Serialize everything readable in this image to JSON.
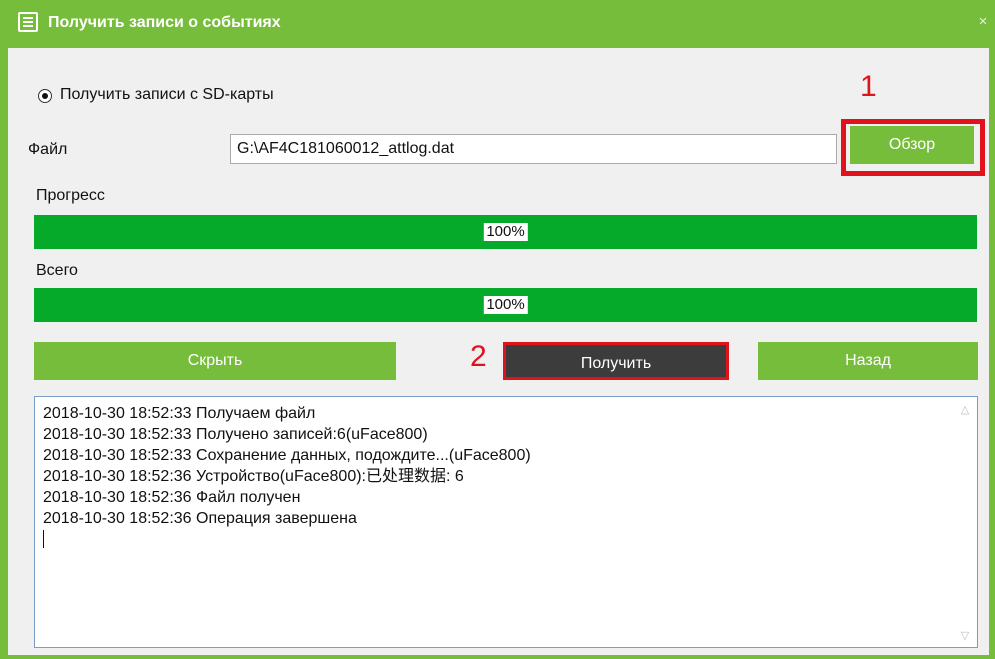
{
  "window": {
    "title": "Получить записи о событиях",
    "close_symbol": "×",
    "title_icon": "list-document-icon"
  },
  "source": {
    "radio_label": "Получить записи с SD-карты",
    "selected": true
  },
  "file": {
    "label": "Файл",
    "value": "G:\\AF4C181060012_attlog.dat",
    "browse_label": "Обзор"
  },
  "progress": {
    "label": "Прогресс",
    "value_text": "100%",
    "value": 100
  },
  "total": {
    "label": "Всего",
    "value_text": "100%",
    "value": 100
  },
  "buttons": {
    "hide_label": "Скрыть",
    "get_label": "Получить",
    "back_label": "Назад"
  },
  "annotations": {
    "marker_1": "1",
    "marker_2": "2",
    "color": "#e0121b"
  },
  "log": {
    "lines": [
      "2018-10-30 18:52:33 Получаем файл",
      "2018-10-30 18:52:33 Получено записей:6(uFace800)",
      "2018-10-30 18:52:33 Сохранение данных, подождите...(uFace800)",
      "2018-10-30 18:52:36 Устройство(uFace800):已处理数据: 6",
      "2018-10-30 18:52:36 Файл получен",
      "2018-10-30 18:52:36 Операция завершена"
    ]
  },
  "colors": {
    "accent_green": "#76bd3b",
    "progress_green": "#06aa2a",
    "dark_button": "#3c3c3c"
  }
}
